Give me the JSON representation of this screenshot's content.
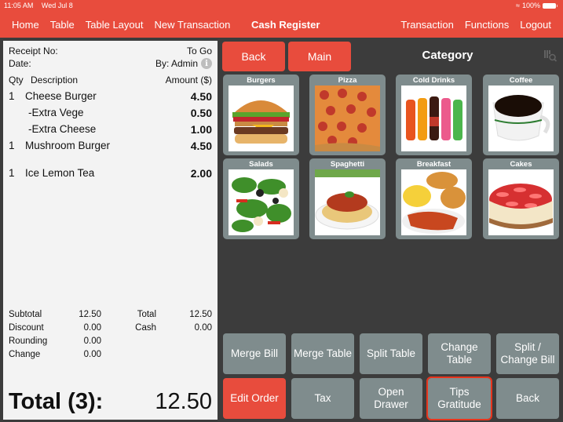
{
  "status_bar": {
    "time": "11:05 AM",
    "date": "Wed Jul 8",
    "battery": "100%"
  },
  "nav": {
    "left": [
      "Home",
      "Table",
      "Table Layout",
      "New Transaction"
    ],
    "title": "Cash Register",
    "right": [
      "Transaction",
      "Functions",
      "Logout"
    ]
  },
  "receipt": {
    "receipt_no_label": "Receipt No:",
    "order_type": "To Go",
    "date_label": "Date:",
    "by": "By: Admin",
    "col_qty": "Qty",
    "col_desc": "Description",
    "col_amount": "Amount ($)",
    "items": [
      {
        "qty": "1",
        "desc": "Cheese Burger",
        "amount": "4.50"
      },
      {
        "qty": "",
        "desc": "-Extra Vege",
        "amount": "0.50"
      },
      {
        "qty": "",
        "desc": "-Extra Cheese",
        "amount": "1.00"
      },
      {
        "qty": "1",
        "desc": "Mushroom Burger",
        "amount": "4.50"
      },
      {
        "qty": "1",
        "desc": "Ice Lemon Tea",
        "amount": "2.00"
      }
    ],
    "totals": {
      "subtotal_label": "Subtotal",
      "subtotal": "12.50",
      "discount_label": "Discount",
      "discount": "0.00",
      "rounding_label": "Rounding",
      "rounding": "0.00",
      "change_label": "Change",
      "change": "0.00",
      "total_label": "Total",
      "total": "12.50",
      "cash_label": "Cash",
      "cash": "0.00"
    },
    "grand_label": "Total (3):",
    "grand_value": "12.50"
  },
  "panel": {
    "back_label": "Back",
    "main_label": "Main",
    "title": "Category",
    "categories": [
      "Burgers",
      "Pizza",
      "Cold Drinks",
      "Coffee",
      "Salads",
      "Spaghetti",
      "Breakfast",
      "Cakes"
    ]
  },
  "functions": {
    "merge_bill": "Merge Bill",
    "merge_table": "Merge Table",
    "split_table": "Split Table",
    "change_table_1": "Change",
    "change_table_2": "Table",
    "split_change_1": "Split /",
    "split_change_2": "Change Bill",
    "edit_order": "Edit Order",
    "tax": "Tax",
    "open_drawer_1": "Open",
    "open_drawer_2": "Drawer",
    "tips_1": "Tips",
    "tips_2": "Gratitude",
    "back": "Back"
  },
  "colors": {
    "accent": "#e84c3d",
    "button_gray": "#7f8c8d",
    "background": "#3c3c3c",
    "receipt": "#f3f3f3"
  }
}
